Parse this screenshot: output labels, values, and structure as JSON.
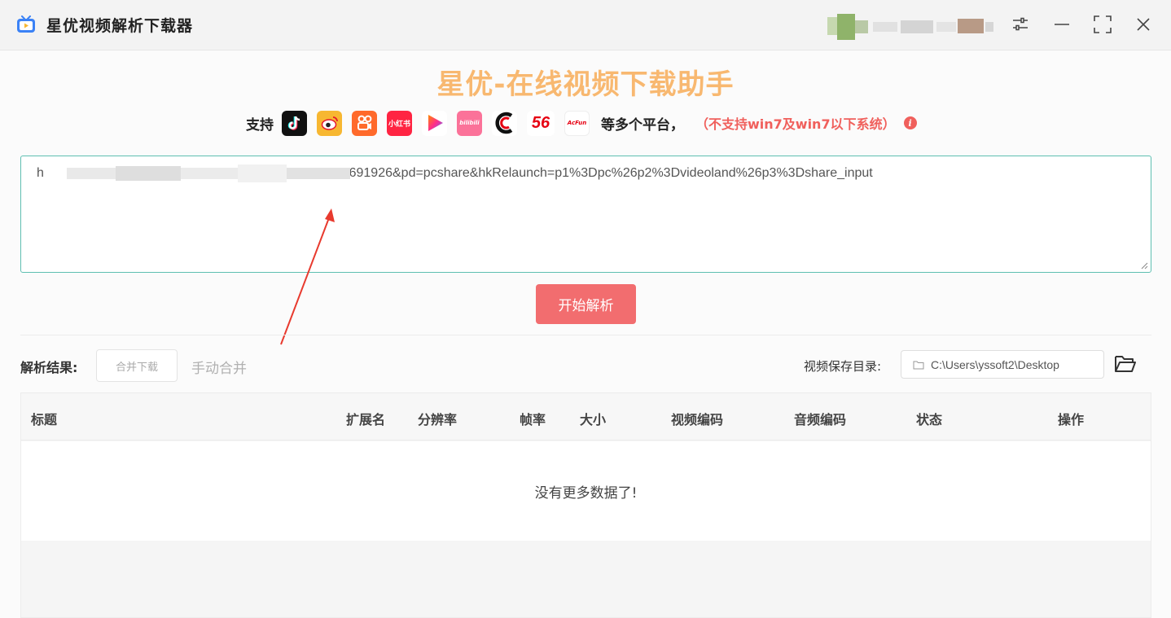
{
  "app": {
    "title": "星优视频解析下载器"
  },
  "window_controls": {
    "settings_icon": "sliders-icon",
    "minimize_icon": "minimize-icon",
    "maximize_icon": "maximize-icon",
    "close_icon": "close-icon"
  },
  "hero": {
    "title": "星优-在线视频下载助手",
    "color": "#f8b870"
  },
  "support": {
    "label": "支持",
    "platforms": [
      {
        "name": "douyin-icon",
        "bg": "#111111"
      },
      {
        "name": "weibo-icon",
        "bg": "#f7b731"
      },
      {
        "name": "kuaishou-icon",
        "bg": "#ff6a2b"
      },
      {
        "name": "xiaohongshu-icon",
        "bg": "#ff2442",
        "text": "小红书"
      },
      {
        "name": "video-play-icon",
        "bg": "#ffffff"
      },
      {
        "name": "bilibili-icon",
        "bg": "#fb7299",
        "text": "bilibili"
      },
      {
        "name": "cctv-icon",
        "bg": "#ffffff"
      },
      {
        "name": "56-icon",
        "bg": "#ffffff",
        "text": "56"
      },
      {
        "name": "acfun-icon",
        "bg": "#ffffff",
        "text": "AcFun"
      }
    ],
    "more_text": "等多个平台，",
    "warning_text": "（不支持win7及win7以下系统）",
    "warning_color": "#f0605c"
  },
  "url_input": {
    "visible_value": "700691926&pd=pcshare&hkRelaunch=p1%3Dpc%26p2%3Dvideoland%26p3%3Dshare_input",
    "prefix_visible": "h"
  },
  "parse_button": {
    "label": "开始解析",
    "color": "#f26d6f"
  },
  "results": {
    "label": "解析结果:",
    "merge_button": "合并下载",
    "manual_merge": "手动合并",
    "save_label": "视频保存目录:",
    "save_path": "C:\\Users\\yssoft2\\Desktop"
  },
  "table": {
    "columns": [
      "标题",
      "扩展名",
      "分辨率",
      "帧率",
      "大小",
      "视频编码",
      "音频编码",
      "状态",
      "操作"
    ],
    "empty_text": "没有更多数据了!"
  }
}
